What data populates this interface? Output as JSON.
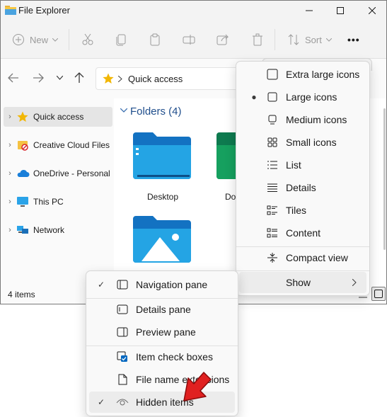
{
  "window": {
    "title": "File Explorer"
  },
  "toolbar": {
    "new_label": "New",
    "sort_label": "Sort",
    "more_label": "•••"
  },
  "address": {
    "location": "Quick access"
  },
  "sidebar": {
    "items": [
      {
        "label": "Quick access",
        "icon": "star-icon"
      },
      {
        "label": "Creative Cloud Files",
        "icon": "creative-cloud-icon"
      },
      {
        "label": "OneDrive - Personal",
        "icon": "cloud-icon"
      },
      {
        "label": "This PC",
        "icon": "monitor-icon"
      },
      {
        "label": "Network",
        "icon": "network-icon"
      }
    ]
  },
  "content": {
    "group_header": "Folders (4)",
    "folders": [
      {
        "label": "Desktop"
      },
      {
        "label": "Do"
      }
    ]
  },
  "status": {
    "items_count": "4 items"
  },
  "view_menu": {
    "items": [
      {
        "label": "Extra large icons",
        "selected": false
      },
      {
        "label": "Large icons",
        "selected": true
      },
      {
        "label": "Medium icons",
        "selected": false
      },
      {
        "label": "Small icons",
        "selected": false
      },
      {
        "label": "List",
        "selected": false
      },
      {
        "label": "Details",
        "selected": false
      },
      {
        "label": "Tiles",
        "selected": false
      },
      {
        "label": "Content",
        "selected": false
      },
      {
        "label": "Compact view",
        "selected": false
      },
      {
        "label": "Show",
        "selected": false
      }
    ]
  },
  "show_menu": {
    "items": [
      {
        "label": "Navigation pane",
        "checked": true
      },
      {
        "label": "Details pane",
        "checked": false
      },
      {
        "label": "Preview pane",
        "checked": false
      },
      {
        "label": "Item check boxes",
        "checked": false
      },
      {
        "label": "File name extensions",
        "checked": false
      },
      {
        "label": "Hidden items",
        "checked": true
      }
    ]
  },
  "colors": {
    "folder_blue": "#1f9de0",
    "accent": "#0067c0",
    "arrow_red": "#e02020"
  }
}
